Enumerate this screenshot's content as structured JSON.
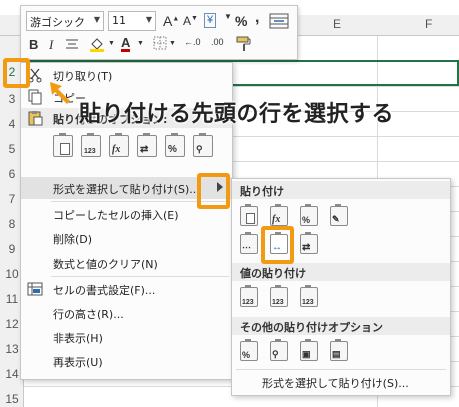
{
  "sheet": {
    "columns": [
      "E",
      "F"
    ],
    "rows": [
      "2",
      "3",
      "4",
      "5",
      "6",
      "7",
      "8",
      "9",
      "10",
      "11",
      "12",
      "13",
      "14",
      "15"
    ]
  },
  "mini_toolbar": {
    "font_name": "游ゴシック",
    "font_size": "11",
    "grow_font": "A",
    "shrink_font": "A",
    "currency": "¥",
    "percent": "%",
    "comma": ",",
    "bold": "B",
    "italic": "I",
    "font_color_letter": "A",
    "dec_inc": "←.0",
    "dec_dec": ".00"
  },
  "context_menu": {
    "cut": "切り取り(T)",
    "copy": "コピー",
    "paste_options": "貼り付けのオプション:",
    "paste_special": "形式を選択して貼り付け(S)...",
    "insert_copied": "コピーしたセルの挿入(E)",
    "delete": "削除(D)",
    "clear_contents": "数式と値のクリア(N)",
    "format_cells": "セルの書式設定(F)...",
    "row_height": "行の高さ(R)...",
    "hide": "非表示(H)",
    "unhide": "再表示(U)"
  },
  "submenu": {
    "paste_section": "貼り付け",
    "values_section": "値の貼り付け",
    "other_section": "その他の貼り付けオプション",
    "paste_special_link": "形式を選択して貼り付け(S)..."
  },
  "icon_text": {
    "num": "123",
    "fx": "fx",
    "pct": "%"
  },
  "callout": "貼り付ける先頭の行を選択する",
  "colors": {
    "accent_orange": "#f29a12",
    "excel_green": "#217346",
    "font_red": "#c00000"
  }
}
